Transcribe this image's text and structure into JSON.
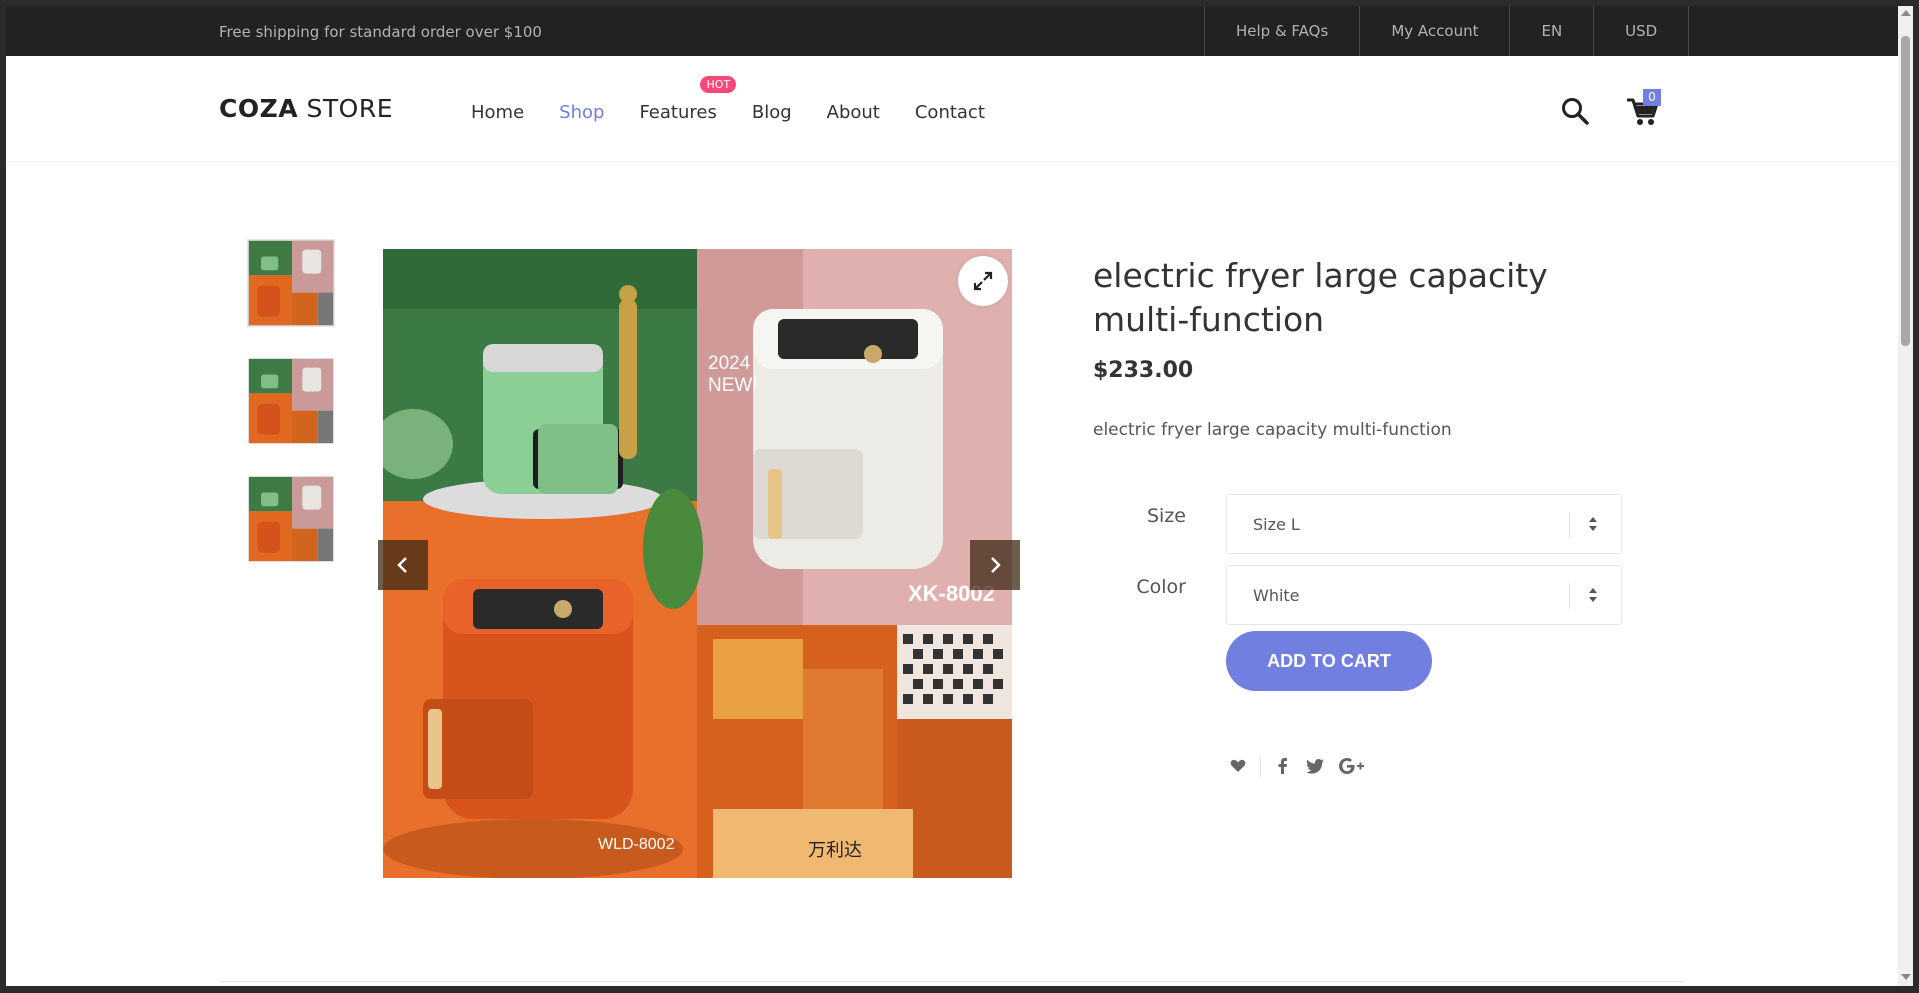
{
  "topbar": {
    "shipping_text": "Free shipping for standard order over $100",
    "links": [
      "Help & FAQs",
      "My Account",
      "EN",
      "USD"
    ]
  },
  "header": {
    "logo_bold": "COZA",
    "logo_light": " STORE",
    "nav": [
      {
        "label": "Home"
      },
      {
        "label": "Shop",
        "active": true
      },
      {
        "label": "Features",
        "badge": "HOT"
      },
      {
        "label": "Blog"
      },
      {
        "label": "About"
      },
      {
        "label": "Contact"
      }
    ],
    "cart_count": "0"
  },
  "product": {
    "title": "electric fryer large capacity multi-function",
    "price": "$233.00",
    "description": "electric fryer large capacity multi-function",
    "size_label": "Size",
    "size_value": "Size L",
    "color_label": "Color",
    "color_value": "White",
    "add_to_cart": "ADD TO CART",
    "image_texts": {
      "new_badge": "2024 NEW!",
      "model_right": "XK-8002",
      "model_left": "WLD-8002",
      "brand_cn": "万利达"
    }
  },
  "colors": {
    "accent": "#717fe0",
    "hot_badge": "#f74877",
    "topbar_bg": "#222222"
  },
  "icons": [
    "search-icon",
    "cart-icon",
    "expand-icon",
    "chevron-left-icon",
    "chevron-right-icon",
    "heart-icon",
    "facebook-icon",
    "twitter-icon",
    "google-plus-icon"
  ]
}
